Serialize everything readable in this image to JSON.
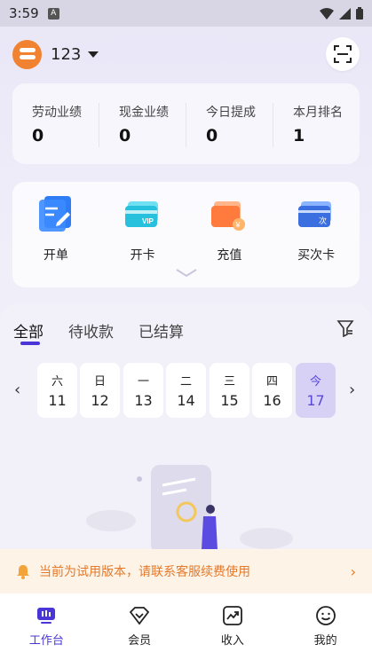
{
  "status": {
    "time": "3:59",
    "sim_label": "A"
  },
  "header": {
    "user_name": "123"
  },
  "stats": [
    {
      "label": "劳动业绩",
      "value": "0"
    },
    {
      "label": "现金业绩",
      "value": "0"
    },
    {
      "label": "今日提成",
      "value": "0"
    },
    {
      "label": "本月排名",
      "value": "1"
    }
  ],
  "actions": [
    {
      "label": "开单",
      "icon": "order-icon"
    },
    {
      "label": "开卡",
      "icon": "vip-card-icon",
      "badge": "VIP"
    },
    {
      "label": "充值",
      "icon": "wallet-icon",
      "badge": "¥"
    },
    {
      "label": "买次卡",
      "icon": "count-card-icon",
      "badge": "次"
    }
  ],
  "tabs": [
    "全部",
    "待收款",
    "已结算"
  ],
  "active_tab": 0,
  "dates": [
    {
      "dow": "六",
      "day": "11"
    },
    {
      "dow": "日",
      "day": "12"
    },
    {
      "dow": "一",
      "day": "13"
    },
    {
      "dow": "二",
      "day": "14"
    },
    {
      "dow": "三",
      "day": "15"
    },
    {
      "dow": "四",
      "day": "16"
    },
    {
      "dow": "今",
      "day": "17"
    }
  ],
  "selected_date": 6,
  "trial_banner": {
    "text": "当前为试用版本，请联系客服续费使用"
  },
  "nav": [
    {
      "label": "工作台",
      "icon": "workbench-icon"
    },
    {
      "label": "会员",
      "icon": "member-icon"
    },
    {
      "label": "收入",
      "icon": "income-icon"
    },
    {
      "label": "我的",
      "icon": "profile-icon"
    }
  ],
  "active_nav": 0,
  "colors": {
    "accent": "#4a36d6",
    "warning": "#e5792a",
    "avatar": "#f08232"
  }
}
